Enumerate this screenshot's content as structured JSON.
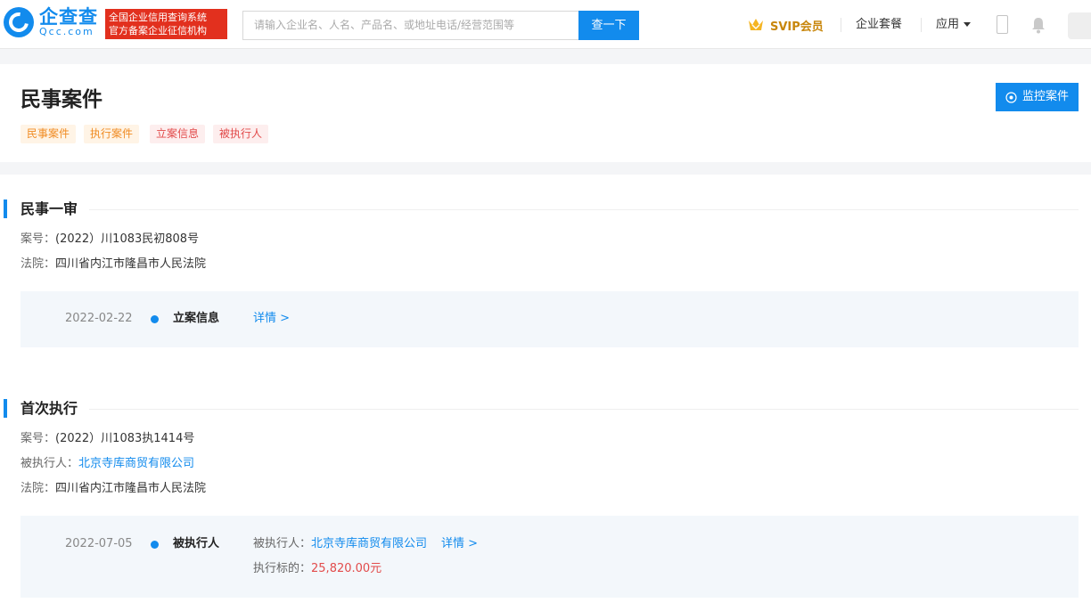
{
  "header": {
    "logo_cn": "企查查",
    "logo_en": "Qcc.com",
    "badge_line1": "全国企业信用查询系统",
    "badge_line2": "官方备案企业征信机构",
    "search_placeholder": "请输入企业名、人名、产品名、或地址电话/经营范围等",
    "search_button": "查一下",
    "svip_label": "SVIP会员",
    "nav_package": "企业套餐",
    "nav_apps": "应用"
  },
  "page": {
    "title": "民事案件",
    "monitor_button": "监控案件",
    "tags": [
      "民事案件",
      "执行案件",
      "立案信息",
      "被执行人"
    ]
  },
  "sections": [
    {
      "title": "民事一审",
      "case_label": "案号：",
      "case_no": "(2022）川1083民初808号",
      "court_label": "法院：",
      "court": "四川省内江市隆昌市人民法院",
      "timeline": {
        "date": "2022-02-22",
        "type": "立案信息",
        "detail_link": "详情 >"
      }
    },
    {
      "title": "首次执行",
      "case_label": "案号：",
      "case_no": "(2022）川1083执1414号",
      "executee_label": "被执行人：",
      "executee": "北京寺库商贸有限公司",
      "court_label": "法院：",
      "court": "四川省内江市隆昌市人民法院",
      "timeline": {
        "date": "2022-07-05",
        "type": "被执行人",
        "executee_label": "被执行人：",
        "executee": "北京寺库商贸有限公司",
        "detail_link": "详情 >",
        "amount_label": "执行标的：",
        "amount": "25,820.00元"
      }
    }
  ],
  "colors": {
    "brand": "#128bed",
    "badge_red": "#e2301e",
    "svip_gold": "#c8860b",
    "money_red": "#e24b4b"
  }
}
